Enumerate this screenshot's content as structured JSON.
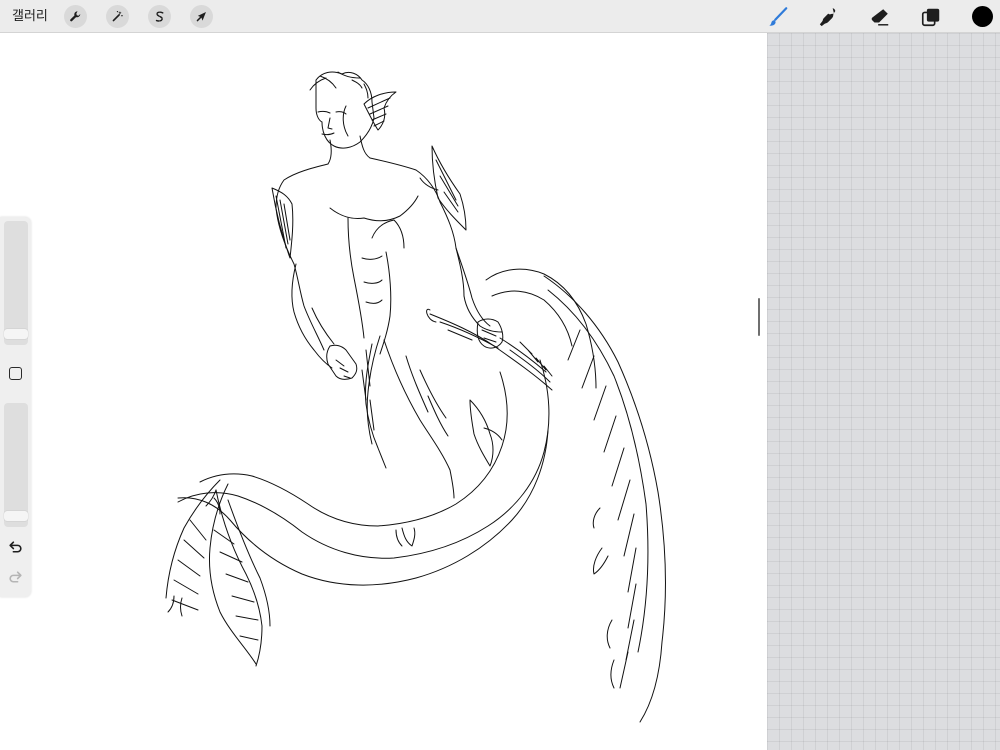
{
  "toolbar": {
    "gallery_label": "갤러리",
    "left_tools": [
      {
        "name": "actions",
        "icon": "wrench-icon"
      },
      {
        "name": "adjustments",
        "icon": "magic-wand-icon"
      },
      {
        "name": "selection",
        "icon": "selection-s-icon"
      },
      {
        "name": "transform",
        "icon": "arrow-cursor-icon"
      }
    ],
    "right_tools": [
      {
        "name": "brush",
        "icon": "brush-icon",
        "active": true
      },
      {
        "name": "smudge",
        "icon": "smudge-icon",
        "active": false
      },
      {
        "name": "eraser",
        "icon": "eraser-icon",
        "active": false
      },
      {
        "name": "layers",
        "icon": "layers-icon",
        "active": false
      }
    ],
    "current_color": "#000000",
    "accent_color": "#2f7bd9"
  },
  "sidebar": {
    "brush_size_level": 0.05,
    "opacity_level": 0.05,
    "modify_icon": "square-icon",
    "undo_icon": "undo-icon",
    "redo_icon": "redo-icon",
    "redo_enabled": false
  },
  "canvas": {
    "background": "#ffffff",
    "artwork": "line-art-sketch"
  }
}
